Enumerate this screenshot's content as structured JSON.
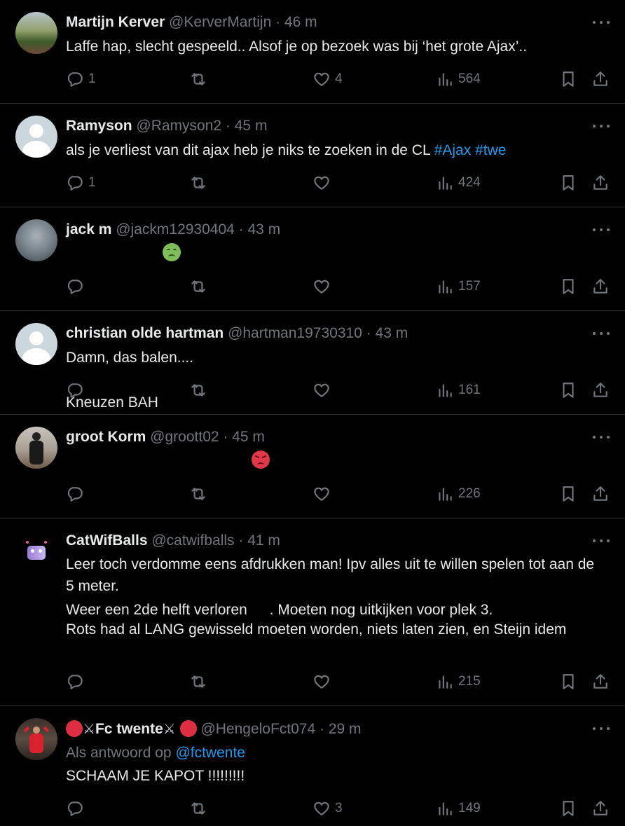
{
  "colors": {
    "background": "#000000",
    "text": "#e7e9ea",
    "muted": "#71767b",
    "link": "#1d9bf0",
    "divider": "#2f3336"
  },
  "tweets": [
    {
      "name": "Martijn Kerver",
      "handle": "@KerverMartijn",
      "time": "46 m",
      "text": "Laffe hap, slecht gespeeld.. Alsof je op bezoek was bij ‘het grote Ajax’..",
      "replies": "1",
      "retweets": "",
      "likes": "4",
      "views": "564"
    },
    {
      "name": "Ramyson",
      "handle": "@Ramyson2",
      "time": "45 m",
      "text": "als je verliest van dit ajax heb je niks te zoeken in de CL ",
      "tags": [
        "#Ajax",
        "#twe"
      ],
      "replies": "1",
      "retweets": "",
      "likes": "",
      "views": "424"
    },
    {
      "name": "jack m",
      "handle": "@jackm12930404",
      "time": "43 m",
      "text": "Kneuzen BAH ",
      "emoji": "nauseated-face",
      "replies": "",
      "retweets": "",
      "likes": "",
      "views": "157"
    },
    {
      "name": "christian olde hartman",
      "handle": "@hartman19730310",
      "time": "43 m",
      "text": "Damn, das balen....",
      "replies": "",
      "retweets": "",
      "likes": "",
      "views": "161"
    },
    {
      "name": "groot Korm",
      "handle": "@groott02",
      "time": "45 m",
      "text_a": "Weer een 2de helft verloren ",
      "emoji": "angry-face",
      "text_b": ". Moeten nog uitkijken voor plek 3.",
      "replies": "",
      "retweets": "",
      "likes": "",
      "views": "226"
    },
    {
      "name": "CatWifBalls",
      "handle": "@catwifballs",
      "time": "41 m",
      "text": "Leer toch verdomme eens afdrukken man! Ipv alles uit te willen spelen tot aan de 5 meter.\n\nRots had al LANG gewisseld moeten worden, niets laten zien, en Steijn idem",
      "replies": "",
      "retweets": "",
      "likes": "",
      "views": "215"
    },
    {
      "name": "Fc twente",
      "name_icons": [
        "red-circle",
        "crossed-swords"
      ],
      "handle": "@HengeloFct074",
      "time": "29 m",
      "reply_label": "Als antwoord op",
      "reply_to": "@fctwente",
      "text": "SCHAAM JE KAPOT !!!!!!!!!",
      "replies": "",
      "retweets": "",
      "likes": "3",
      "views": "149"
    }
  ],
  "sep": " · "
}
